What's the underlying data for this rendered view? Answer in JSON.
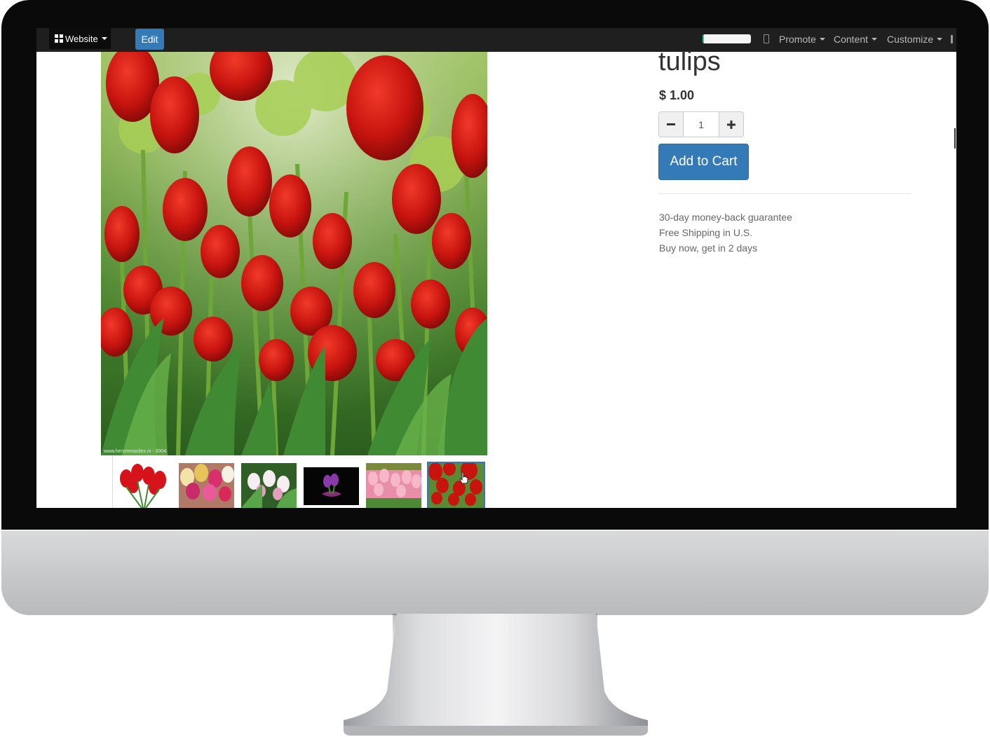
{
  "toolbar": {
    "apps_label": "Website",
    "edit_label": "Edit",
    "progress_fraction": 0.03,
    "menus": [
      "Promote",
      "Content",
      "Customize"
    ]
  },
  "product": {
    "name": "tulips",
    "price": "$ 1.00",
    "quantity": "1",
    "add_to_cart_label": "Add to Cart",
    "benefits": [
      "30-day money-back guarantee",
      "Free Shipping in U.S.",
      "Buy now, get in 2 days"
    ],
    "image_caption": "www.hersmmaslies.ni - 2004",
    "thumbnails": [
      "red-tulips",
      "pink-white-tulips",
      "white-tulips",
      "purple-tulip-dark",
      "pink-tulips-field",
      "red-tulips-field"
    ],
    "active_thumbnail": 6
  },
  "colors": {
    "accent": "#337ab7",
    "topbar": "#1f1f1f",
    "tulip_red": "#c81414"
  }
}
